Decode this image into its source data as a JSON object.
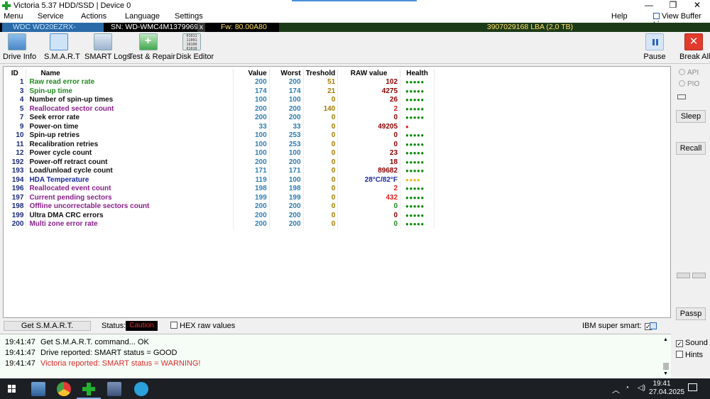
{
  "window": {
    "title": "Victoria 5.37 HDD/SSD | Device 0",
    "minimize": "—",
    "restore": "❐",
    "close": "✕"
  },
  "menu": {
    "items": [
      "Menu",
      "Service",
      "Actions",
      "Language",
      "Settings"
    ],
    "help": "Help",
    "buffer": "View Buffer Live"
  },
  "drive": {
    "model": "WDC WD20EZRX-00D8PB0",
    "serial": "SN: WD-WMC4M1379969",
    "close": "x",
    "firmware": "Fw: 80.00A80",
    "lba": "3907029168 LBA (2,0 TB)"
  },
  "toolbar": {
    "drive_info": "Drive Info",
    "smart": "S.M.A.R.T",
    "smart_logs": "SMART Logs",
    "test_repair": "Test & Repair",
    "disk_editor": "Disk Editor",
    "disk_editor_bits": "01011\n11001\n10100\n01010",
    "pause": "Pause",
    "break_all": "Break All",
    "break_glyph": "✕"
  },
  "table": {
    "headers": {
      "id": "ID",
      "name": "Name",
      "value": "Value",
      "worst": "Worst",
      "threshold": "Treshold",
      "raw": "RAW value",
      "health": "Health"
    },
    "rows": [
      {
        "id": "1",
        "name": "Raw read error rate",
        "value": "200",
        "worst": "200",
        "threshold": "51",
        "raw": "102",
        "health": "●●●●●",
        "name_color": "#1f8a1f",
        "raw_color": "#8b0000",
        "health_color": "#0a8a0a"
      },
      {
        "id": "3",
        "name": "Spin-up time",
        "value": "174",
        "worst": "174",
        "threshold": "21",
        "raw": "4275",
        "health": "●●●●●",
        "name_color": "#1f8a1f",
        "raw_color": "#8b0000",
        "health_color": "#0a8a0a"
      },
      {
        "id": "4",
        "name": "Number of spin-up times",
        "value": "100",
        "worst": "100",
        "threshold": "0",
        "raw": "26",
        "health": "●●●●●",
        "name_color": "#111111",
        "raw_color": "#8b0000",
        "health_color": "#0a8a0a"
      },
      {
        "id": "5",
        "name": "Reallocated sector count",
        "value": "200",
        "worst": "200",
        "threshold": "140",
        "raw": "2",
        "health": "●●●●●",
        "name_color": "#8a1f8a",
        "raw_color": "#e02020",
        "health_color": "#0a8a0a"
      },
      {
        "id": "7",
        "name": "Seek error rate",
        "value": "200",
        "worst": "200",
        "threshold": "0",
        "raw": "0",
        "health": "●●●●●",
        "name_color": "#111111",
        "raw_color": "#8b0000",
        "health_color": "#0a8a0a"
      },
      {
        "id": "9",
        "name": "Power-on time",
        "value": "33",
        "worst": "33",
        "threshold": "0",
        "raw": "49205",
        "health": "●",
        "name_color": "#111111",
        "raw_color": "#8b0000",
        "health_color": "#e02020"
      },
      {
        "id": "10",
        "name": "Spin-up retries",
        "value": "100",
        "worst": "253",
        "threshold": "0",
        "raw": "0",
        "health": "●●●●●",
        "name_color": "#111111",
        "raw_color": "#8b0000",
        "health_color": "#0a8a0a"
      },
      {
        "id": "11",
        "name": "Recalibration retries",
        "value": "100",
        "worst": "253",
        "threshold": "0",
        "raw": "0",
        "health": "●●●●●",
        "name_color": "#111111",
        "raw_color": "#8b0000",
        "health_color": "#0a8a0a"
      },
      {
        "id": "12",
        "name": "Power cycle count",
        "value": "100",
        "worst": "100",
        "threshold": "0",
        "raw": "23",
        "health": "●●●●●",
        "name_color": "#111111",
        "raw_color": "#8b0000",
        "health_color": "#0a8a0a"
      },
      {
        "id": "192",
        "name": "Power-off retract count",
        "value": "200",
        "worst": "200",
        "threshold": "0",
        "raw": "18",
        "health": "●●●●●",
        "name_color": "#111111",
        "raw_color": "#8b0000",
        "health_color": "#0a8a0a"
      },
      {
        "id": "193",
        "name": "Load/unload cycle count",
        "value": "171",
        "worst": "171",
        "threshold": "0",
        "raw": "89682",
        "health": "●●●●●",
        "name_color": "#111111",
        "raw_color": "#8b0000",
        "health_color": "#0a8a0a"
      },
      {
        "id": "194",
        "name": "HDA Temperature",
        "value": "119",
        "worst": "100",
        "threshold": "0",
        "raw": "28°C/82°F",
        "health": "●●●●",
        "name_color": "#1a2c9c",
        "raw_color": "#1a2c9c",
        "health_color": "#e8b923"
      },
      {
        "id": "196",
        "name": "Reallocated event count",
        "value": "198",
        "worst": "198",
        "threshold": "0",
        "raw": "2",
        "health": "●●●●●",
        "name_color": "#8a1f8a",
        "raw_color": "#e02020",
        "health_color": "#0a8a0a"
      },
      {
        "id": "197",
        "name": "Current pending sectors",
        "value": "199",
        "worst": "199",
        "threshold": "0",
        "raw": "432",
        "health": "●●●●●",
        "name_color": "#8a1f8a",
        "raw_color": "#e02020",
        "health_color": "#0a8a0a"
      },
      {
        "id": "198",
        "name": "Offline uncorrectable sectors count",
        "value": "200",
        "worst": "200",
        "threshold": "0",
        "raw": "0",
        "health": "●●●●●",
        "name_color": "#8a1f8a",
        "raw_color": "#1f8a1f",
        "health_color": "#0a8a0a"
      },
      {
        "id": "199",
        "name": "Ultra DMA CRC errors",
        "value": "200",
        "worst": "200",
        "threshold": "0",
        "raw": "0",
        "health": "●●●●●",
        "name_color": "#111111",
        "raw_color": "#8b0000",
        "health_color": "#0a8a0a"
      },
      {
        "id": "200",
        "name": "Multi zone error rate",
        "value": "200",
        "worst": "200",
        "threshold": "0",
        "raw": "0",
        "health": "●●●●●",
        "name_color": "#8a1f8a",
        "raw_color": "#1f8a1f",
        "health_color": "#0a8a0a"
      }
    ]
  },
  "side": {
    "api": "API",
    "pio": "PIO",
    "sleep": "Sleep",
    "recall": "Recall",
    "passp": "Passp"
  },
  "status": {
    "get_smart": "Get S.M.A.R.T.",
    "label": "Status:",
    "value": "Caution",
    "hex": "HEX raw values",
    "ibm": "IBM super smart:",
    "ibm_checked": "✓"
  },
  "log": {
    "lines": [
      {
        "time": "19:41:47",
        "text": "Get S.M.A.R.T. command... OK",
        "warn": false
      },
      {
        "time": "19:41:47",
        "text": "Drive reported: SMART status = GOOD",
        "warn": false
      },
      {
        "time": "19:41:47",
        "text": "Victoria reported: SMART status = WARNING!",
        "warn": true
      }
    ],
    "scroll_up": "▲",
    "scroll_down": "▼",
    "sound": "Sound",
    "sound_checked": "✓",
    "hints": "Hints"
  },
  "taskbar": {
    "tray_chevron": "︿",
    "time": "19:41",
    "date": "27.04.2025"
  }
}
